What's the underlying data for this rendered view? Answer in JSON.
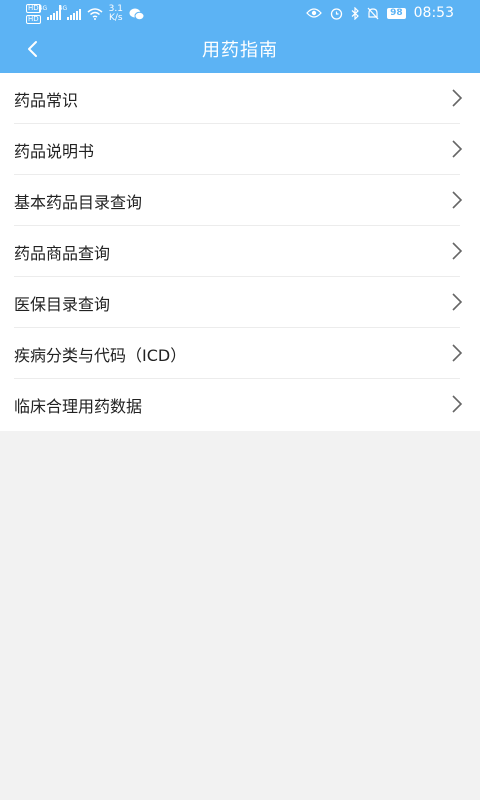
{
  "status_bar": {
    "hd_badge": "HD",
    "network_tag": "4G",
    "speed_value": "3.1",
    "speed_unit": "K/s",
    "battery": "98",
    "time": "08:53"
  },
  "header": {
    "title": "用药指南",
    "color": "#5cb3f4"
  },
  "menu": {
    "items": [
      {
        "label": "药品常识"
      },
      {
        "label": "药品说明书"
      },
      {
        "label": "基本药品目录查询"
      },
      {
        "label": "药品商品查询"
      },
      {
        "label": "医保目录查询"
      },
      {
        "label": "疾病分类与代码（ICD）"
      },
      {
        "label": "临床合理用药数据"
      }
    ]
  }
}
